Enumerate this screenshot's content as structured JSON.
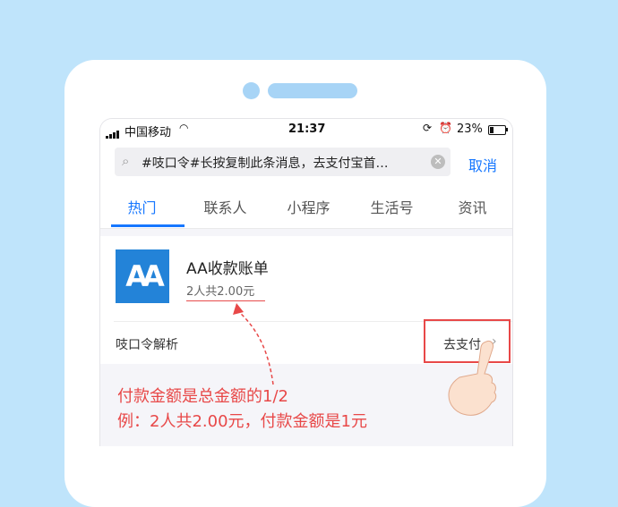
{
  "status": {
    "carrier": "中国移动",
    "time": "21:37",
    "battery": "23%"
  },
  "search": {
    "query": "#吱口令#长按复制此条消息，去支付宝首…",
    "cancel": "取消"
  },
  "tabs": [
    {
      "label": "热门",
      "active": true
    },
    {
      "label": "联系人"
    },
    {
      "label": "小程序"
    },
    {
      "label": "生活号"
    },
    {
      "label": "资讯"
    }
  ],
  "result": {
    "logo_text": "AA",
    "title": "AA收款账单",
    "subtitle": "2人共2.00元",
    "parse_label": "吱口令解析",
    "pay_label": "去支付"
  },
  "note": {
    "line1": "付款金额是总金额的1/2",
    "line2": "例：2人共2.00元，付款金额是1元"
  },
  "colors": {
    "accent": "#1677ff",
    "highlight": "#e84848",
    "background": "#bfe4fb",
    "logo": "#2383d8"
  }
}
